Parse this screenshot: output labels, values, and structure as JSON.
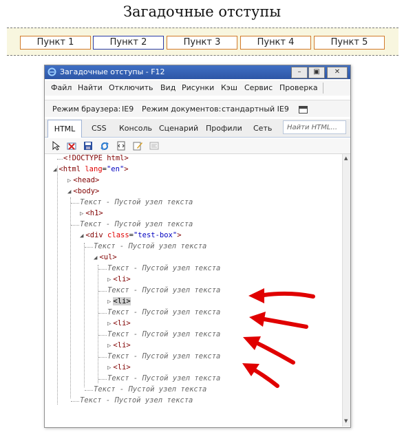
{
  "page": {
    "title": "Загадочные отступы",
    "menu": [
      "Пункт 1",
      "Пункт 2",
      "Пункт 3",
      "Пункт 4",
      "Пункт 5"
    ]
  },
  "devtools": {
    "window_title": "Загадочные отступы - F12",
    "menu": [
      "Файл",
      "Найти",
      "Отключить",
      "Вид",
      "Рисунки",
      "Кэш",
      "Сервис",
      "Проверка"
    ],
    "browser_mode_label": "Режим браузера:",
    "browser_mode_value": "IE9",
    "doc_mode_label": "Режим документов:",
    "doc_mode_value": "стандартный IE9",
    "tabs": [
      "HTML",
      "CSS",
      "Консоль",
      "Сценарий",
      "Профили",
      "Сеть"
    ],
    "active_tab": "HTML",
    "find_placeholder": "Найти HTML...",
    "text_node_label": "Текст - Пустой узел текста",
    "doctype": "<!DOCTYPE html>",
    "html_tag": "<html",
    "lang_attr": "lang",
    "lang_value": "\"en\"",
    "head_tag": "<head>",
    "body_tag": "<body>",
    "h1_tag": "<h1>",
    "div_tag": "<div",
    "class_attr": "class",
    "class_value": "\"test-box\"",
    "ul_tag": "<ul>",
    "li_tag": "<li>"
  },
  "colors": {
    "titlebar": "#2d56a6",
    "arrow": "#e00000",
    "menu_border": "#d27a2a",
    "menu_active_border": "#2a3aa6",
    "menu_bg": "#f8f6df"
  }
}
